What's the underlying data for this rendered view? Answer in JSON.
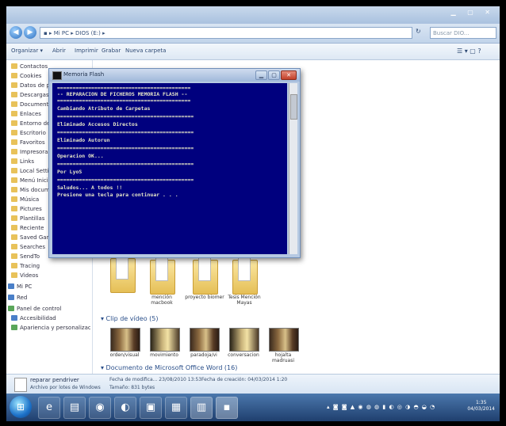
{
  "explorer": {
    "window_controls": "▁ ▢ ✕",
    "address": "▪ ▸ Mi PC ▸ DIOS (E:) ▸",
    "search_placeholder": "Buscar DIO...",
    "toolbar": [
      "Organizar ▾",
      "Abrir",
      "Imprimir",
      "Grabar",
      "Nueva carpeta"
    ],
    "toolbar_right": "☰ ▾  ▢  ?"
  },
  "sidebar": {
    "items": [
      "Contactos",
      "Cookies",
      "Datos de programa",
      "Descargas",
      "Documentos",
      "Enlaces",
      "Entorno de red",
      "Escritorio",
      "Favoritos",
      "Impresoras",
      "Links",
      "Local Settings",
      "Menú Inicio",
      "Mis documentos",
      "Música",
      "Pictures",
      "Plantillas",
      "Reciente",
      "Saved Games",
      "Searches",
      "SendTo",
      "Tracing",
      "Videos",
      "Mi PC",
      "Red",
      "Panel de control",
      "Accesibilidad",
      "Apariencia y personalización"
    ]
  },
  "content": {
    "folders": [
      "",
      "mención macbook",
      "proyecto biomer",
      "Tesis Mención Mayas"
    ],
    "section_video": "▾ Clip de vídeo (5)",
    "videos": [
      "orden/visual",
      "movimiento",
      "paradoja/vi",
      "conversacion",
      "hojalta madruasi"
    ],
    "section_word": "▾ Documento de Microsoft Office Word (16)"
  },
  "details": {
    "filename": "reparar pendriver",
    "filetype": "Archivo por lotes de Windows",
    "modified": "Fecha de modifica... 23/08/2010 13:53",
    "size": "Tamaño: 831 bytes",
    "created": "Fecha de creación: 04/03/2014 1:20"
  },
  "console": {
    "title": "Memoria Flash",
    "controls": [
      "▁",
      "▢",
      "✕"
    ],
    "lines": [
      "===========================================",
      "-- REPARACION DE FICHEROS MEMORIA FLASH --",
      "===========================================",
      "Cambiando Atributo de Carpetas",
      "============================================",
      "Eliminado Accesos Directos",
      "============================================",
      "Eliminado Autorun",
      "============================================",
      "Operacion OK...",
      "============================================",
      "Por LyoS",
      "============================================",
      "Saludos... A todos !!",
      "Presione una tecla para continuar . . ."
    ]
  },
  "taskbar": {
    "start": "⊞",
    "buttons": [
      "e",
      "▤",
      "◉",
      "◐",
      "▣",
      "▦",
      "▥",
      "▪"
    ],
    "tray_icons": "▴ ◙ ◙ ▲ ◉ ◍ ◍ ▮ ◐ ◎ ◑ ◓ ◒ ◔",
    "clock_time": "1:35",
    "clock_date": "04/03/2014"
  }
}
